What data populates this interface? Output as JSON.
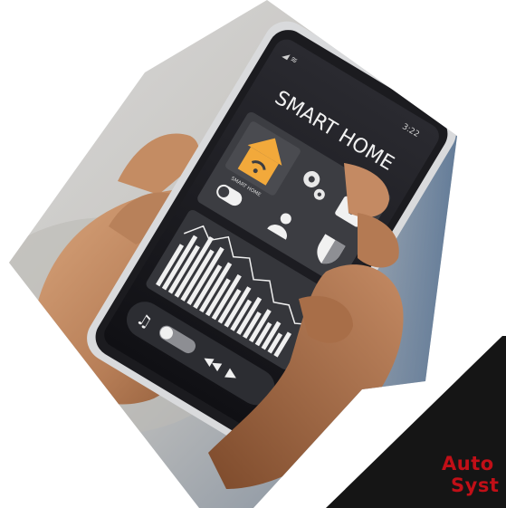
{
  "photo": {
    "screen_title": "SMART HOME",
    "status_time": "3:22",
    "tile_label": "SMART HOME",
    "icons": [
      "home-wifi-icon",
      "gears-icon",
      "lock-icon",
      "toggle-icon",
      "person-icon",
      "shield-icon",
      "music-note-icon",
      "rewind-icon",
      "play-icon"
    ]
  },
  "caption": {
    "line1": "Auto",
    "line2": "Syst"
  },
  "colors": {
    "accent": "#f2a93b",
    "caption_text": "#c10f17",
    "dark_panel": "#151515"
  }
}
